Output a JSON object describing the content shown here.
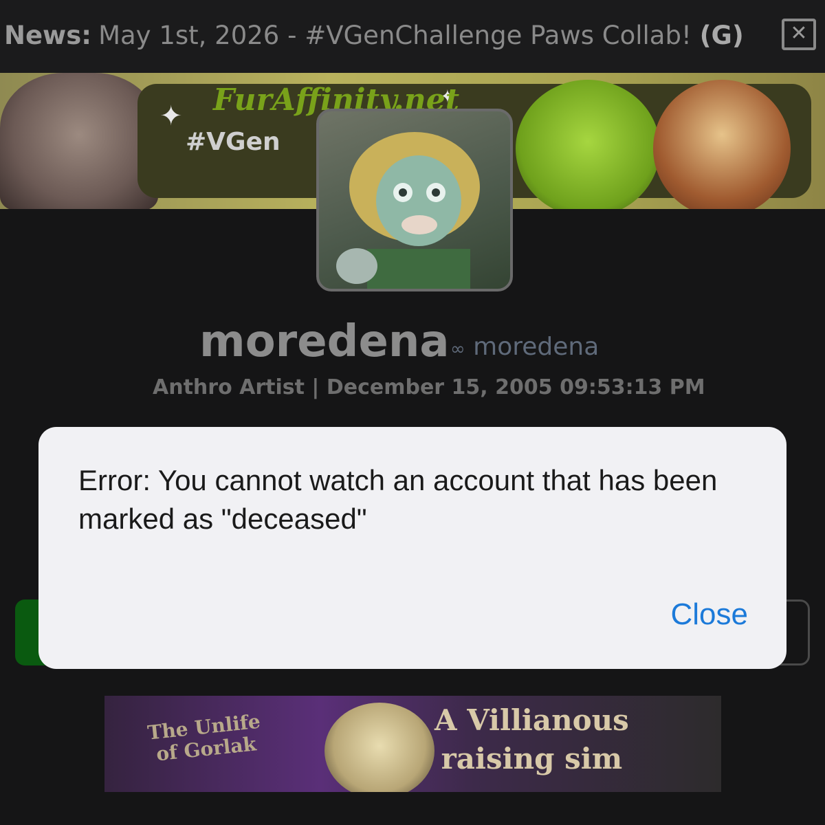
{
  "news": {
    "label": "News:",
    "text": "May 1st, 2026 - #VGenChallenge Paws Collab!",
    "rating": "(G)",
    "close_glyph": "✕",
    "close_icon": "close-icon"
  },
  "banner": {
    "logo": "FurAffinity.net",
    "tag": "#VGen"
  },
  "profile": {
    "username": "moredena",
    "alt_handle": "moredena",
    "alt_icon": "infinity-link-icon",
    "user_type": "Anthro Artist",
    "separator": "|",
    "join_date": "December 15, 2005 09:53:13 PM"
  },
  "alert": {
    "message": "Error: You cannot watch an account that has been marked as \"deceased\"",
    "close_label": "Close"
  },
  "ad": {
    "left_title_1": "The Unlife",
    "left_title_2": "of Gorlak",
    "right_line_1": "A Villianous",
    "right_line_2": "raising sim"
  },
  "colors": {
    "background": "#151516",
    "alert_bg": "#f1f1f4",
    "link_blue": "#1c7ad9",
    "watch_green": "#0a5a10"
  }
}
